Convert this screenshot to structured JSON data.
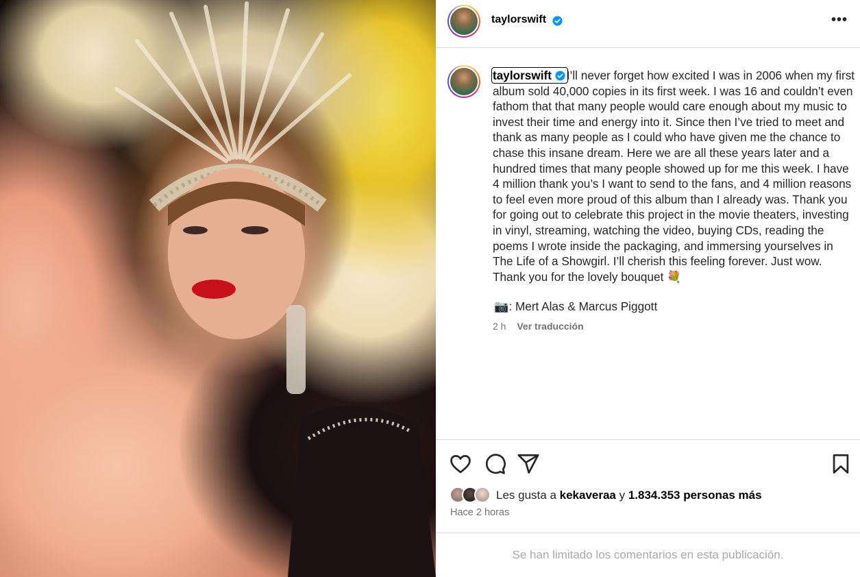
{
  "post": {
    "username": "taylorswift",
    "more_label": "•••",
    "caption": "I’ll never forget how excited I was in 2006 when my first album sold 40,000 copies in its first week. I was 16 and couldn’t even fathom that that many people would care enough about my music to invest their time and energy into it. Since then I’ve tried to meet and thank as many people as I could who have given me the chance to chase this insane dream. Here we are all these years later and a hundred times that many people showed up for me this week. I have 4 million thank you’s I want to send to the fans, and 4 million reasons to feel even more proud of this album than I already was. Thank you for going out to celebrate this project in the movie theaters, investing in vinyl, streaming, watching the video, buying CDs, reading the poems I wrote inside the packaging, and immersing yourselves in The Life of a Showgirl. I’ll cherish this feeling forever. Just wow. Thank you for the lovely bouquet 💐",
    "photo_credit": "📷: Mert Alas & Marcus Piggott",
    "caption_age": "2 h",
    "translate_label": "Ver traducción",
    "likes_prefix": "Les gusta a ",
    "likes_user": "kekaveraa",
    "likes_middle": " y ",
    "likes_count": "1.834.353 personas más",
    "posted_ago": "Hace 2 horas",
    "comments_limited": "Se han limitado los comentarios en esta publicación."
  },
  "icons": {
    "verified": "verified-badge-icon",
    "like": "heart-icon",
    "comment": "comment-bubble-icon",
    "share": "paper-plane-icon",
    "save": "bookmark-icon",
    "more": "more-options-icon"
  },
  "colors": {
    "verified_blue": "#0095f6",
    "secondary_text": "#737373",
    "muted_text": "#a8a8a8",
    "divider": "#dbdbdb"
  }
}
